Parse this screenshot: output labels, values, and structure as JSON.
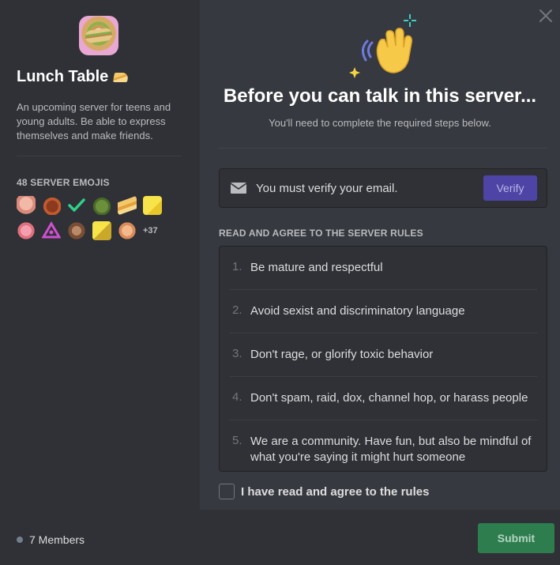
{
  "sidebar": {
    "server_name": "Lunch Table",
    "server_description": "An upcoming server for teens and young adults. Be able to express themselves and make friends.",
    "emoji_header": "48 SERVER EMOJIS",
    "emojis": [
      "hands-emoji",
      "cat-emoji",
      "checkmark-emoji",
      "frog-emoji",
      "sandwich-emoji",
      "chick-emoji",
      "patrick-emoji",
      "triangle-emoji",
      "ape-emoji",
      "spongebob-emoji",
      "face-emoji"
    ],
    "emoji_more": "+37",
    "members": "7 Members"
  },
  "main": {
    "title": "Before you can talk in this server...",
    "subtitle": "You'll need to complete the required steps below.",
    "verify": {
      "text": "You must verify your email.",
      "button_label": "Verify"
    },
    "rules_header": "READ AND AGREE TO THE SERVER RULES",
    "rules": [
      {
        "num": "1.",
        "text": "Be mature and respectful"
      },
      {
        "num": "2.",
        "text": "Avoid sexist and discriminatory language"
      },
      {
        "num": "3.",
        "text": "Don't rage, or glorify toxic behavior"
      },
      {
        "num": "4.",
        "text": "Don't spam, raid, dox, channel hop, or harass people"
      },
      {
        "num": "5.",
        "text": "We are a community. Have fun, but also be mindful of what you're saying it might hurt someone"
      }
    ],
    "agree_label": "I have read and agree to the rules",
    "submit_label": "Submit"
  },
  "colors": {
    "sidebar_bg": "#2f3136",
    "main_bg": "#36393f",
    "verify_button": "#4e44a6",
    "submit_button": "#2d7d4f"
  }
}
